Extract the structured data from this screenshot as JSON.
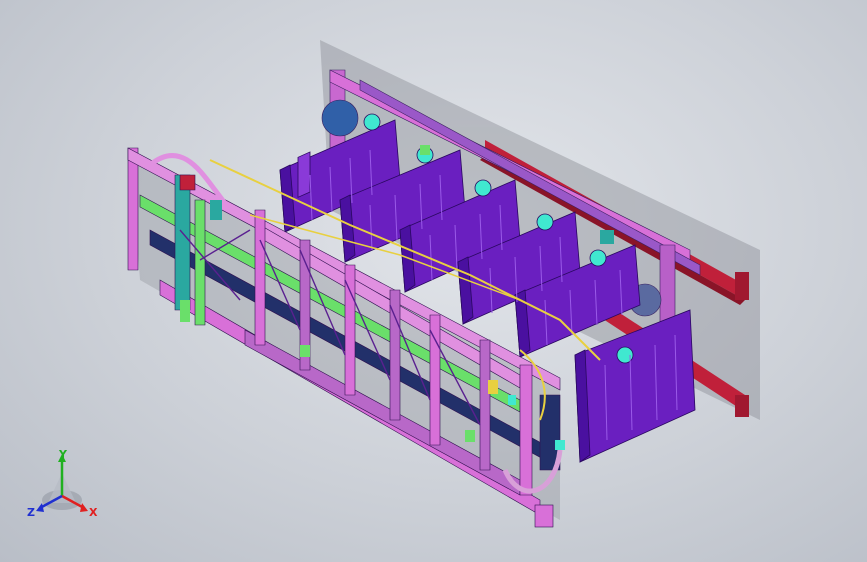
{
  "viewport": {
    "background_top": "#e2e5ea",
    "background_bottom": "#b9bec7"
  },
  "model": {
    "description_icon": "cad-assembly-isometric",
    "colors": {
      "frame_magenta": "#d870d8",
      "frame_pink": "#e090e0",
      "panel_purple": "#6a1fc0",
      "panel_purple_dark": "#4a10a0",
      "panel_inner": "#8a3ad8",
      "cyan": "#40e8d0",
      "green": "#6adf6a",
      "yellow": "#e8d040",
      "red_beam": "#c0203a",
      "navy": "#22306a",
      "teal": "#2aa8a0",
      "shadow": "#8c8f96"
    }
  },
  "triad": {
    "x_label": "X",
    "y_label": "Y",
    "z_label": "Z",
    "x_color": "#e02020",
    "y_color": "#20b020",
    "z_color": "#2030d0"
  }
}
